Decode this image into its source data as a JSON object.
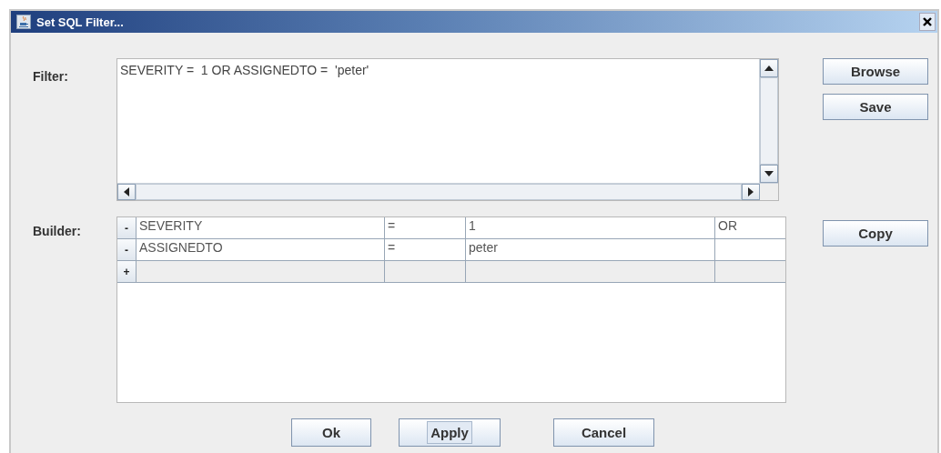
{
  "window": {
    "title": "Set SQL Filter..."
  },
  "filter": {
    "label": "Filter:",
    "value": "SEVERITY =  1 OR ASSIGNEDTO =  'peter'"
  },
  "side_buttons": [
    {
      "label": "Browse",
      "focused": false
    },
    {
      "label": "Save",
      "focused": false
    }
  ],
  "builder": {
    "label": "Builder:",
    "rows": [
      {
        "kind": "condition",
        "sign": "-",
        "field": "SEVERITY",
        "operator": "=",
        "value": "1",
        "connector": "OR"
      },
      {
        "kind": "condition",
        "sign": "-",
        "field": "ASSIGNEDTO",
        "operator": "=",
        "value": "peter"
      },
      {
        "kind": "add",
        "sign": "+"
      }
    ]
  },
  "builder_buttons": [
    {
      "label": "Copy",
      "focused": false
    }
  ],
  "buttons": [
    {
      "label": "Ok",
      "focused": false
    },
    {
      "label": "Apply",
      "focused": true
    },
    {
      "label": "Cancel",
      "focused": false
    }
  ]
}
